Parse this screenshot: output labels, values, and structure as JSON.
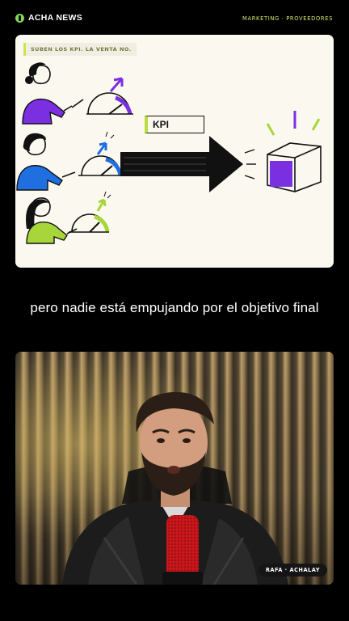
{
  "header": {
    "brand": "ACHA NEWS",
    "section": "MARKETING · PROVEEDORES"
  },
  "card": {
    "tag": "SUBEN LOS KPI. LA VENTA NO.",
    "arrow_label": "KPI",
    "colors": {
      "purple": "#7a2fe0",
      "blue": "#1f6fe0",
      "green": "#a7d63a",
      "accent": "#c8e64b"
    },
    "gauges": [
      {
        "color": "purple",
        "level": 0.7
      },
      {
        "color": "blue",
        "level": 0.75
      },
      {
        "color": "green",
        "level": 0.7
      }
    ]
  },
  "caption": "pero nadie está empujando por el objetivo final",
  "video": {
    "presenter": "RAFA · ACHALAY"
  }
}
